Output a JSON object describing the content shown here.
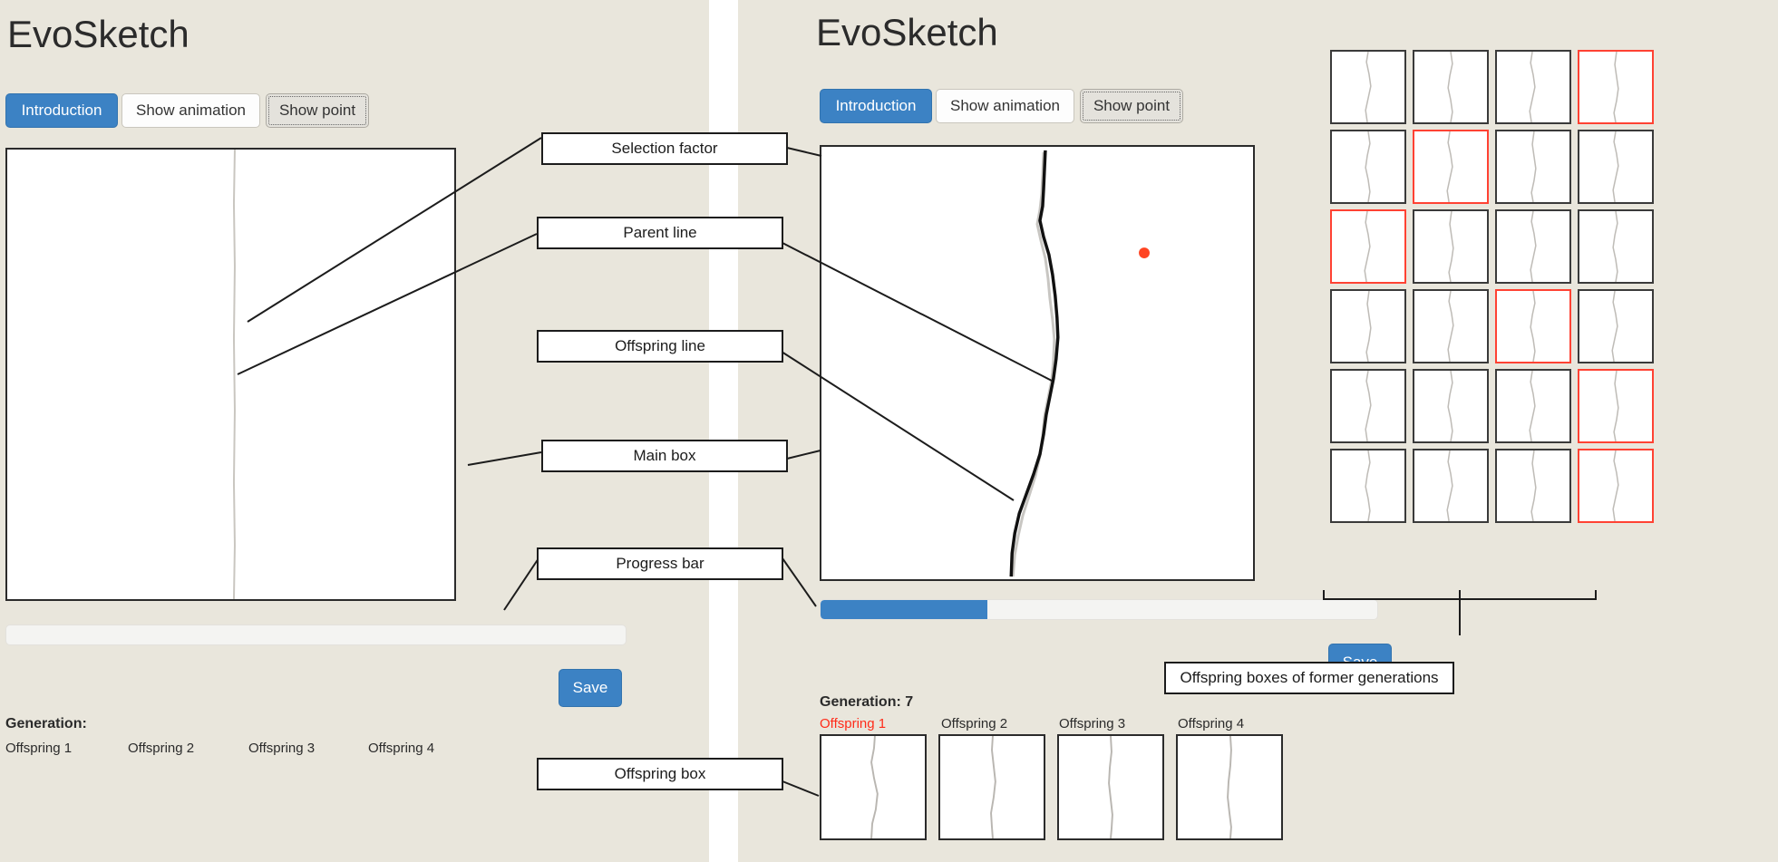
{
  "app": {
    "title": "EvoSketch",
    "accent_color": "#3c82c4",
    "selected_color": "#ff2b19",
    "background_color": "#e9e6dc"
  },
  "left_panel": {
    "title": "EvoSketch",
    "buttons": [
      {
        "label": "Introduction",
        "style": "primary"
      },
      {
        "label": "Show animation",
        "style": "default"
      },
      {
        "label": "Show point",
        "style": "focus"
      }
    ],
    "save_label": "Save",
    "generation_label": "Generation:",
    "generation_value": "",
    "offspring_labels": [
      "Offspring 1",
      "Offspring 2",
      "Offspring 3",
      "Offspring 4"
    ],
    "progress_percent": 0
  },
  "right_panel": {
    "title": "EvoSketch",
    "buttons": [
      {
        "label": "Introduction",
        "style": "primary"
      },
      {
        "label": "Show animation",
        "style": "default"
      },
      {
        "label": "Show point",
        "style": "focus"
      }
    ],
    "save_label": "Save",
    "generation_label": "Generation:",
    "generation_value": "7",
    "generation_text": "Generation: 7",
    "offspring_labels": [
      "Offspring 1",
      "Offspring 2",
      "Offspring 3",
      "Offspring 4"
    ],
    "selected_offspring_index": 0,
    "progress_percent": 30
  },
  "history_grid": {
    "rows": 6,
    "cols": 4,
    "selected_cells": [
      {
        "row": 0,
        "col": 3
      },
      {
        "row": 1,
        "col": 1
      },
      {
        "row": 2,
        "col": 0
      },
      {
        "row": 3,
        "col": 2
      },
      {
        "row": 4,
        "col": 3
      },
      {
        "row": 5,
        "col": 3
      }
    ],
    "caption": "Offspring  boxes of former  generations"
  },
  "callouts": [
    {
      "id": "selection-factor",
      "label": "Selection factor"
    },
    {
      "id": "parent-line",
      "label": "Parent line"
    },
    {
      "id": "offspring-line",
      "label": "Offspring  line"
    },
    {
      "id": "main-box",
      "label": "Main box"
    },
    {
      "id": "progress-bar",
      "label": "Progress bar"
    },
    {
      "id": "offspring-box",
      "label": "Offspring  box"
    }
  ]
}
